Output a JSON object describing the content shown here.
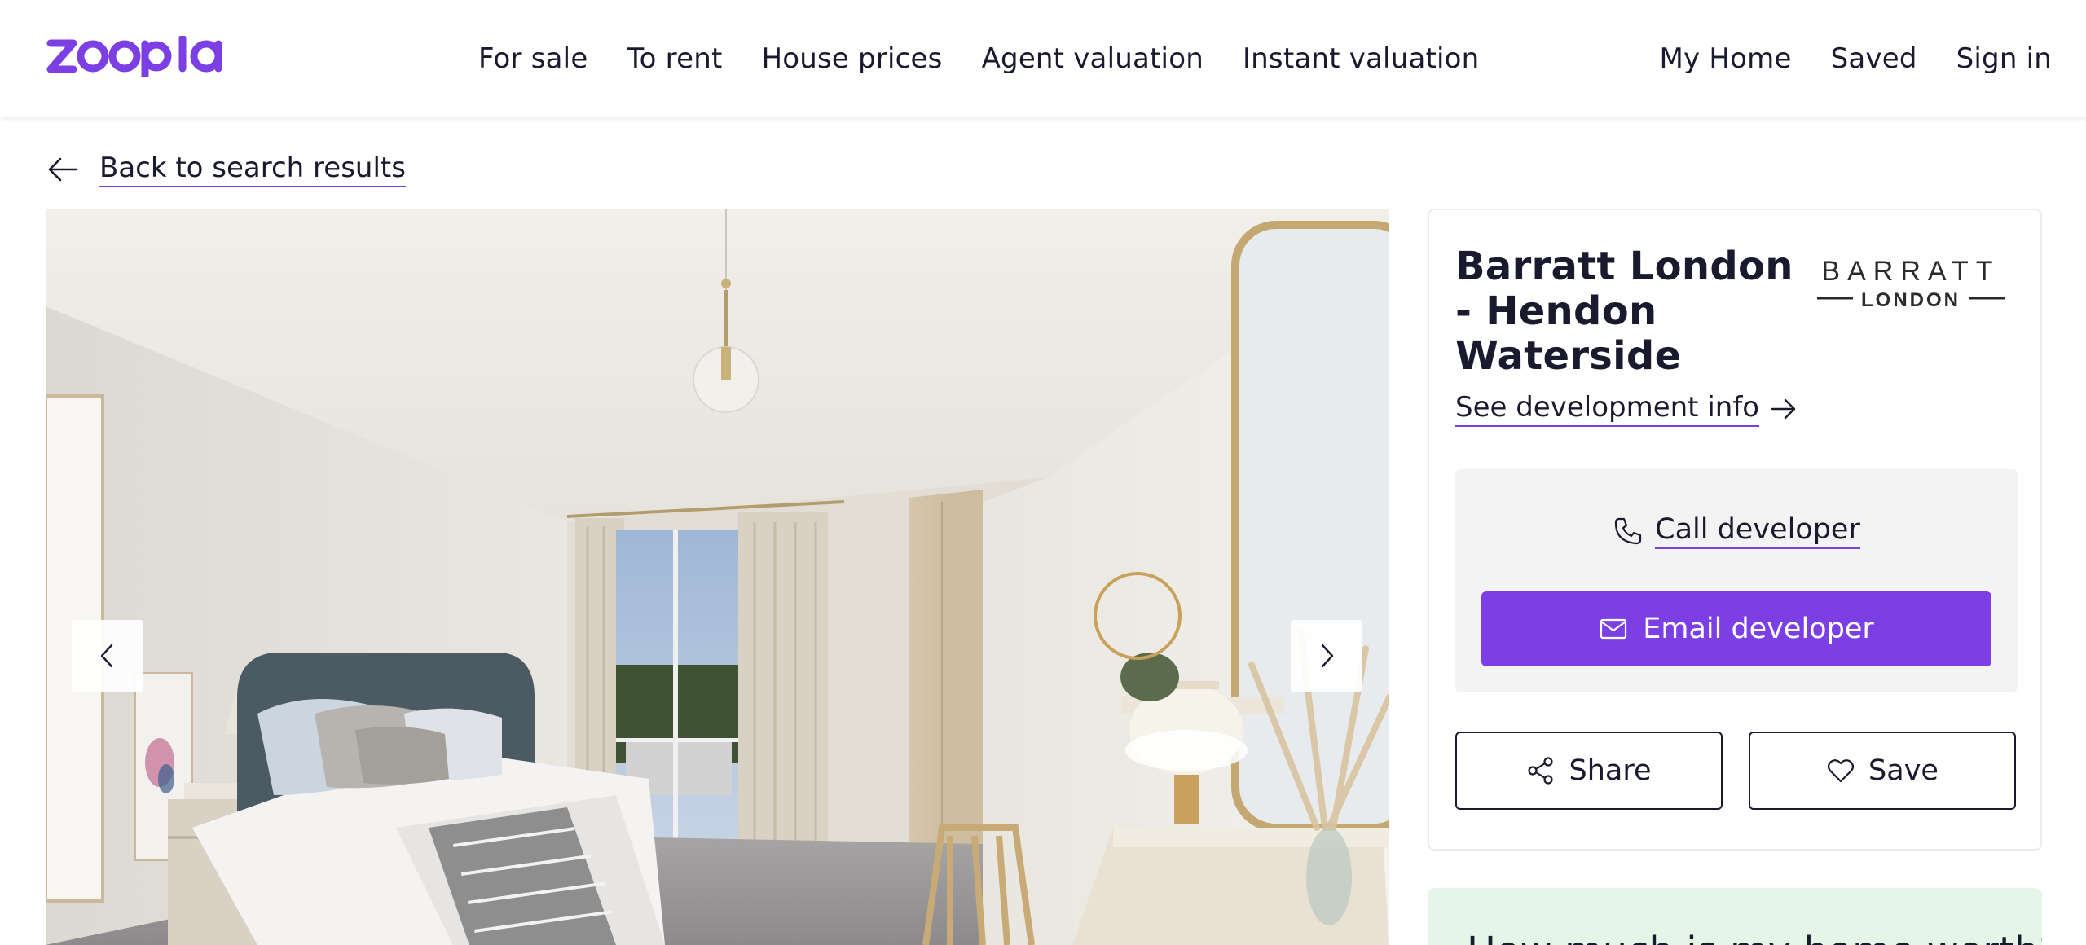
{
  "brand": {
    "logo_text": "zoopla",
    "accent_color": "#7b3fe4"
  },
  "header": {
    "nav_main": [
      "For sale",
      "To rent",
      "House prices",
      "Agent valuation",
      "Instant valuation"
    ],
    "nav_right": [
      "My Home",
      "Saved",
      "Sign in"
    ]
  },
  "back_link": {
    "label": "Back to search results",
    "icon": "arrow-left-icon"
  },
  "gallery": {
    "image_description": "Furnished bedroom show home",
    "prev_icon": "chevron-left-icon",
    "next_icon": "chevron-right-icon"
  },
  "developer": {
    "name": "Barratt London - Hendon Waterside",
    "logo_text_top": "BARRATT",
    "logo_text_bottom": "LONDON",
    "info_link": "See development info",
    "call_label": "Call developer",
    "email_label": "Email developer",
    "share_label": "Share",
    "save_label": "Save"
  },
  "promo": {
    "text": "How much is my home worth?"
  }
}
